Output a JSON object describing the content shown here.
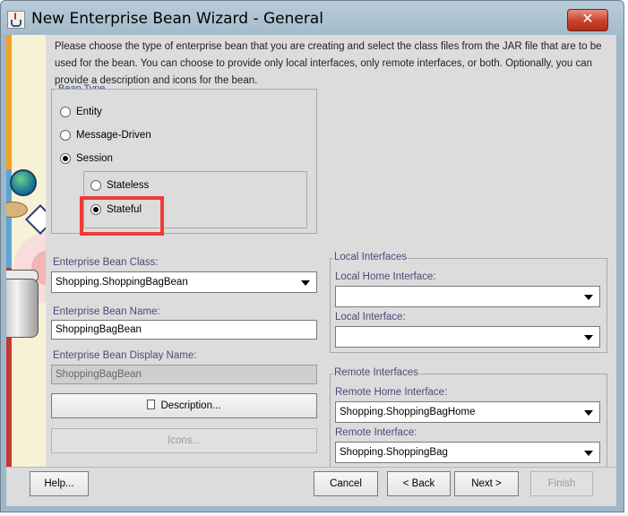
{
  "window": {
    "title": "New Enterprise Bean Wizard - General",
    "close_glyph": "✕"
  },
  "intro": {
    "text": "Please choose the type of enterprise bean that you are creating and select the class files from the JAR file that are to be used for the bean.  You can choose to provide only local interfaces, only remote interfaces, or both. Optionally, you can provide a description and icons for the bean."
  },
  "bean_type": {
    "label": "Bean Type",
    "options": [
      {
        "label": "Entity",
        "selected": false
      },
      {
        "label": "Message-Driven",
        "selected": false
      },
      {
        "label": "Session",
        "selected": true
      }
    ],
    "session_options": [
      {
        "label": "Stateless",
        "selected": false
      },
      {
        "label": "Stateful",
        "selected": true
      }
    ]
  },
  "fields": {
    "class_label": "Enterprise Bean Class:",
    "class_value": "Shopping.ShoppingBagBean",
    "name_label": "Enterprise Bean Name:",
    "name_value": "ShoppingBagBean",
    "display_label": "Enterprise Bean Display Name:",
    "display_value": "ShoppingBagBean"
  },
  "buttons": {
    "description": "Description...",
    "icons": "Icons...",
    "help": "Help...",
    "cancel": "Cancel",
    "back": "< Back",
    "next": "Next >",
    "finish": "Finish"
  },
  "local": {
    "title": "Local Interfaces",
    "home_label": "Local Home Interface:",
    "home_value": "",
    "iface_label": "Local Interface:",
    "iface_value": ""
  },
  "remote": {
    "title": "Remote Interfaces",
    "home_label": "Remote Home Interface:",
    "home_value": "Shopping.ShoppingBagHome",
    "iface_label": "Remote Interface:",
    "iface_value": "Shopping.ShoppingBag"
  },
  "colors": {
    "highlight": "#ef3b37",
    "close_button": "#c7412a",
    "label_text": "#4a4a7a"
  }
}
